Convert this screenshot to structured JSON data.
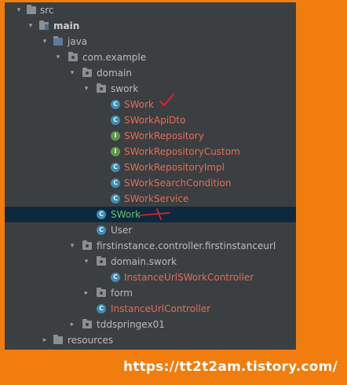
{
  "tree": {
    "items": [
      {
        "label": "src",
        "kind": "folder",
        "arrow": "▾"
      },
      {
        "label": "main",
        "kind": "src-folder",
        "arrow": "▾"
      },
      {
        "label": "java",
        "kind": "src-folder",
        "arrow": "▾"
      },
      {
        "label": "com.example",
        "kind": "package",
        "arrow": "▾"
      },
      {
        "label": "domain",
        "kind": "package",
        "arrow": "▾"
      },
      {
        "label": "swork",
        "kind": "package",
        "arrow": "▾"
      },
      {
        "label": "SWork",
        "kind": "class",
        "icon_letter": "C",
        "status": "error"
      },
      {
        "label": "SWorkApiDto",
        "kind": "class",
        "icon_letter": "C",
        "status": "error"
      },
      {
        "label": "SWorkRepository",
        "kind": "interface",
        "icon_letter": "I",
        "status": "error"
      },
      {
        "label": "SWorkRepositoryCustom",
        "kind": "interface",
        "icon_letter": "I",
        "status": "error"
      },
      {
        "label": "SWorkRepositoryImpl",
        "kind": "class",
        "icon_letter": "C",
        "status": "error"
      },
      {
        "label": "SWorkSearchCondition",
        "kind": "class",
        "icon_letter": "C",
        "status": "error"
      },
      {
        "label": "SWorkService",
        "kind": "class",
        "icon_letter": "C",
        "status": "error"
      },
      {
        "label": "SWork",
        "kind": "class",
        "icon_letter": "C",
        "status": "selected"
      },
      {
        "label": "User",
        "kind": "class",
        "icon_letter": "C",
        "status": "normal"
      },
      {
        "label": "firstinstance.controller.firstinstanceurl",
        "kind": "package",
        "arrow": "▾"
      },
      {
        "label": "domain.swork",
        "kind": "package",
        "arrow": "▾"
      },
      {
        "label": "InstanceUrlSWorkController",
        "kind": "class",
        "icon_letter": "C",
        "status": "error"
      },
      {
        "label": "form",
        "kind": "package",
        "arrow": "▸"
      },
      {
        "label": "InstanceUrlController",
        "kind": "class",
        "icon_letter": "C",
        "status": "error"
      },
      {
        "label": "tddspringex01",
        "kind": "package",
        "arrow": "▸"
      },
      {
        "label": "resources",
        "kind": "folder",
        "arrow": "▸"
      }
    ]
  },
  "watermark": {
    "text": "https://tt2t2am.tistory.com/"
  },
  "colors": {
    "background": "#f07d0e",
    "panel": "#3c3f41",
    "error_text": "#e06c5a",
    "selected_text": "#6bbf6a",
    "selection": "#0d293e",
    "annotation": "#e0202a"
  }
}
